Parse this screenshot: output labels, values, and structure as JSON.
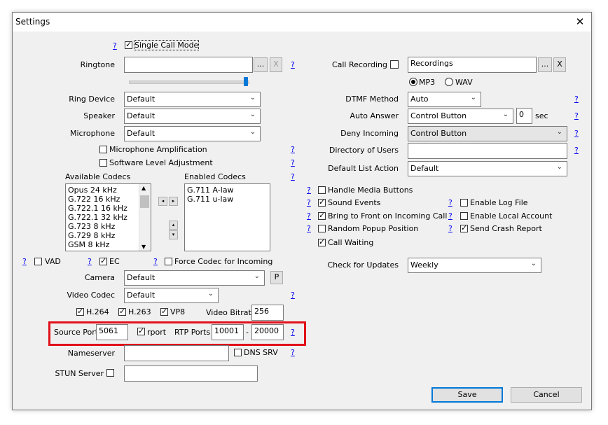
{
  "window": {
    "title": "Settings",
    "close_glyph": "✕"
  },
  "help_glyph": "?",
  "single_call_mode": {
    "label": "Single Call Mode",
    "checked": true
  },
  "ringtone": {
    "label": "Ringtone",
    "value": "",
    "browse": "...",
    "clear": "X",
    "volume_fraction": 1.0
  },
  "call_recording": {
    "label": "Call Recording",
    "checked": false,
    "value": "Recordings",
    "browse": "...",
    "clear": "X",
    "formats": [
      {
        "label": "MP3",
        "selected": true
      },
      {
        "label": "WAV",
        "selected": false
      }
    ]
  },
  "ring_device": {
    "label": "Ring Device",
    "value": "Default"
  },
  "speaker": {
    "label": "Speaker",
    "value": "Default"
  },
  "microphone": {
    "label": "Microphone",
    "value": "Default"
  },
  "mic_amplification": {
    "label": "Microphone Amplification",
    "checked": false
  },
  "software_level": {
    "label": "Software Level Adjustment",
    "checked": false
  },
  "codecs": {
    "available_label": "Available Codecs",
    "enabled_label": "Enabled Codecs",
    "available": [
      "Opus 24 kHz",
      "G.722 16 kHz",
      "G.722.1 16 kHz",
      "G.722.1 32 kHz",
      "G.723 8 kHz",
      "G.729 8 kHz",
      "GSM 8 kHz"
    ],
    "enabled": [
      "G.711 A-law",
      "G.711 u-law"
    ],
    "move_left": "◂",
    "move_right": "▸",
    "move_up": "▴",
    "move_down": "▾"
  },
  "vad": {
    "label": "VAD",
    "checked": false
  },
  "ec": {
    "label": "EC",
    "checked": true
  },
  "force_codec": {
    "label": "Force Codec for Incoming",
    "checked": false
  },
  "camera": {
    "label": "Camera",
    "value": "Default",
    "button": "P"
  },
  "video_codec": {
    "label": "Video Codec",
    "value": "Default"
  },
  "video_formats": [
    {
      "label": "H.264",
      "checked": true
    },
    {
      "label": "H.263",
      "checked": true
    },
    {
      "label": "VP8",
      "checked": true
    }
  ],
  "video_bitrate": {
    "label": "Video Bitrate",
    "value": "256"
  },
  "source_port": {
    "label": "Source Port",
    "value": "5061"
  },
  "rport": {
    "label": "rport",
    "checked": true
  },
  "rtp_ports": {
    "label": "RTP Ports",
    "from": "10001",
    "separator": "-",
    "to": "20000"
  },
  "nameserver": {
    "label": "Nameserver",
    "value": ""
  },
  "dns_srv": {
    "label": "DNS SRV",
    "checked": false
  },
  "stun_server": {
    "label": "STUN Server",
    "checked": false,
    "value": ""
  },
  "dtmf_method": {
    "label": "DTMF Method",
    "value": "Auto"
  },
  "auto_answer": {
    "label": "Auto Answer",
    "value": "Control Button",
    "seconds": "0",
    "unit": "sec"
  },
  "deny_incoming": {
    "label": "Deny Incoming",
    "value": "Control Button"
  },
  "directory_of_users": {
    "label": "Directory of Users",
    "value": ""
  },
  "default_list_action": {
    "label": "Default List Action",
    "value": "Default"
  },
  "right_checks": {
    "handle_media_buttons": {
      "label": "Handle Media Buttons",
      "checked": false
    },
    "sound_events": {
      "label": "Sound Events",
      "checked": true
    },
    "bring_to_front": {
      "label": "Bring to Front on Incoming Call",
      "checked": true
    },
    "random_popup": {
      "label": "Random Popup Position",
      "checked": false
    },
    "call_waiting": {
      "label": "Call Waiting",
      "checked": true
    },
    "enable_log_file": {
      "label": "Enable Log File",
      "checked": false
    },
    "enable_local_account": {
      "label": "Enable Local Account",
      "checked": false
    },
    "send_crash_report": {
      "label": "Send Crash Report",
      "checked": true
    }
  },
  "check_for_updates": {
    "label": "Check for Updates",
    "value": "Weekly"
  },
  "buttons": {
    "save": "Save",
    "cancel": "Cancel"
  },
  "colors": {
    "highlight_box": "#e0101a",
    "accent": "#0078d7",
    "link": "#0000ee"
  }
}
